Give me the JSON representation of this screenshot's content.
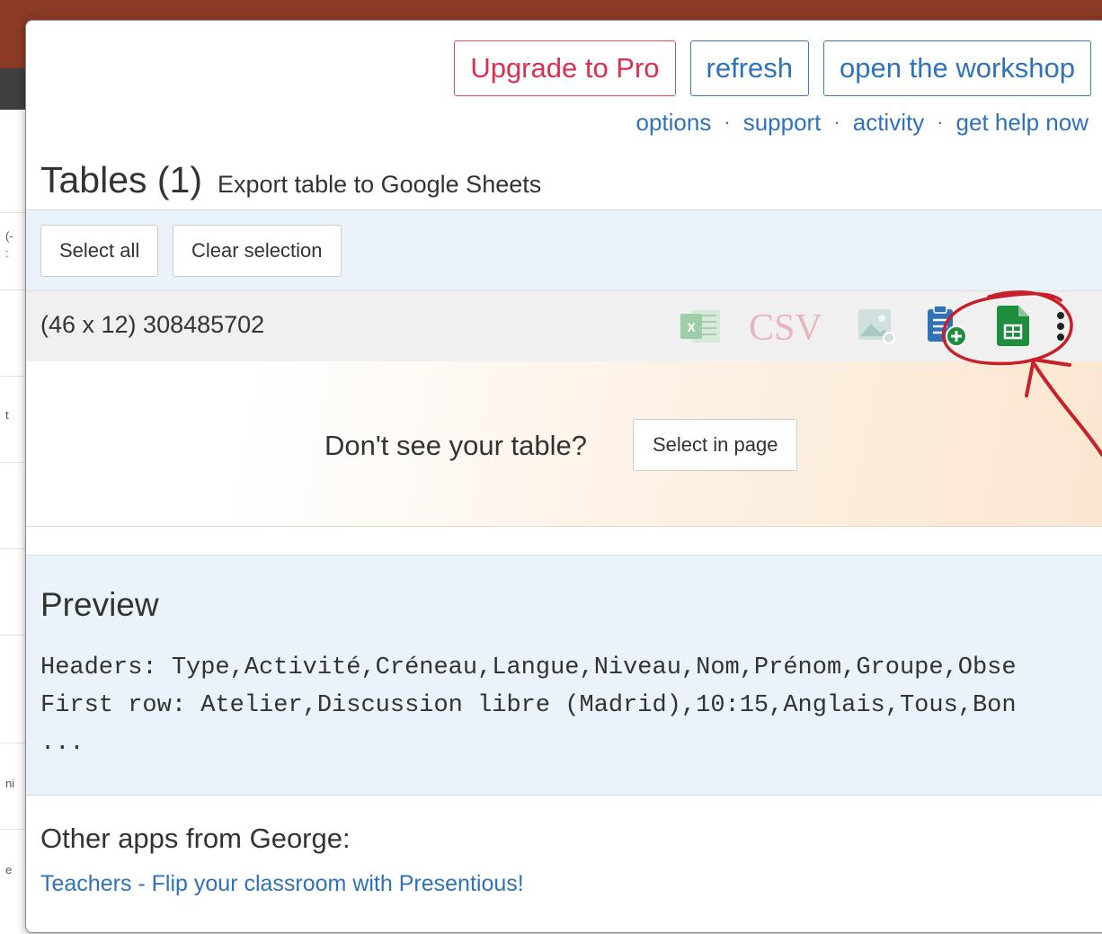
{
  "header": {
    "upgrade_label": "Upgrade to Pro",
    "refresh_label": "refresh",
    "workshop_label": "open the workshop"
  },
  "links": {
    "options": "options",
    "support": "support",
    "activity": "activity",
    "help": "get help now",
    "separator": "·"
  },
  "tables": {
    "title": "Tables (1)",
    "subtitle": "Export table to Google Sheets",
    "select_all": "Select all",
    "clear_selection": "Clear selection",
    "items": [
      {
        "name": "(46 x 12) 308485702"
      }
    ],
    "export_icons": [
      "excel-icon",
      "csv-icon",
      "image-icon",
      "clipboard-add-icon",
      "google-sheets-icon",
      "more-vertical-icon"
    ],
    "csv_label": "CSV"
  },
  "not_see": {
    "text": "Don't see your table?",
    "button": "Select in page"
  },
  "preview": {
    "title": "Preview",
    "headers_line": "Headers: Type,Activité,Créneau,Langue,Niveau,Nom,Prénom,Groupe,Obse",
    "first_row_line": "First row: Atelier,Discussion libre (Madrid),10:15,Anglais,Tous,Bon",
    "ellipsis": "..."
  },
  "other_apps": {
    "title": "Other apps from George:",
    "link": "Teachers - Flip your classroom with Presentious!"
  },
  "background": {
    "fragments": [
      "(-",
      ":",
      "t",
      "ni",
      "e"
    ]
  },
  "colors": {
    "accent_blue": "#2f72b8",
    "pro_red": "#d9304f",
    "annotation_red": "#c8202a",
    "sheets_green": "#1e8e3e",
    "csv_pink": "#e8b4be"
  }
}
